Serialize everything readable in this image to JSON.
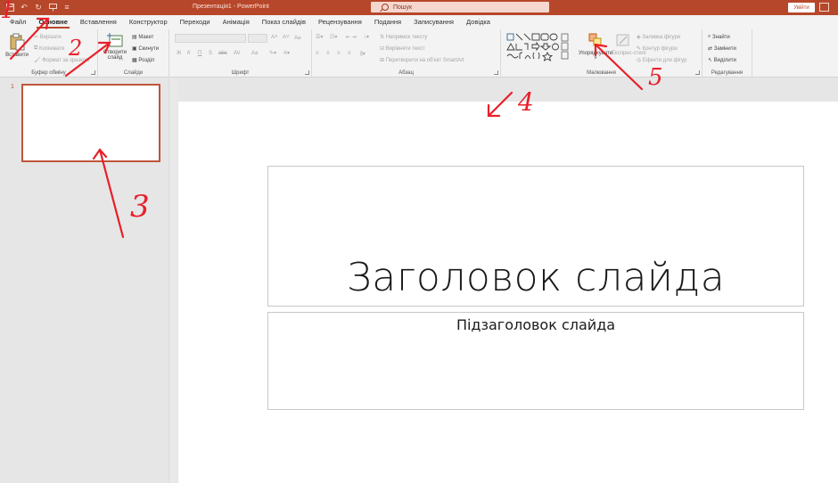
{
  "titlebar": {
    "title": "Презентація1 - PowerPoint",
    "search_placeholder": "Пошук",
    "sign_in": "Увійти",
    "icons": [
      "save-icon",
      "undo-icon",
      "redo-icon",
      "present-icon",
      "customize-icon"
    ]
  },
  "tabs": [
    {
      "label": "Файл",
      "active": false
    },
    {
      "label": "Основне",
      "active": true
    },
    {
      "label": "Вставлення",
      "active": false
    },
    {
      "label": "Конструктор",
      "active": false
    },
    {
      "label": "Переходи",
      "active": false
    },
    {
      "label": "Анімація",
      "active": false
    },
    {
      "label": "Показ слайдів",
      "active": false
    },
    {
      "label": "Рецензування",
      "active": false
    },
    {
      "label": "Подання",
      "active": false
    },
    {
      "label": "Записування",
      "active": false
    },
    {
      "label": "Довідка",
      "active": false
    }
  ],
  "ribbon": {
    "clipboard": {
      "label": "Буфер обміну",
      "paste": "Вставити",
      "cut": "Вирізати",
      "copy": "Копіювати",
      "format_painter": "Формат за зразком"
    },
    "slides": {
      "label": "Слайди",
      "new_slide_line1": "Створити",
      "new_slide_line2": "слайд",
      "layout": "Макет",
      "reset": "Скинути",
      "section": "Розділ"
    },
    "font": {
      "label": "Шрифт",
      "bold": "Ж",
      "italic": "К",
      "underline": "П",
      "strike": "S",
      "shadow": "abc",
      "spacing": "AV",
      "case": "Aa"
    },
    "paragraph": {
      "label": "Абзац",
      "text_direction": "Напрямок тексту",
      "align_text": "Вирівняти текст",
      "convert_smartart": "Перетворити на об'єкт SmartArt"
    },
    "drawing": {
      "label": "Малювання",
      "arrange": "Упорядкувати",
      "quick_styles": "Експрес-стилі",
      "shape_fill": "Заливка фігури",
      "shape_outline": "Контур фігури",
      "shape_effects": "Ефекти для фігур"
    },
    "editing": {
      "label": "Редагування",
      "find": "Знайти",
      "replace": "Замінити",
      "select": "Виділити"
    }
  },
  "thumbnails": [
    {
      "number": "1"
    }
  ],
  "slide": {
    "title_placeholder": "Заголовок слайда",
    "subtitle_placeholder": "Підзаголовок слайда"
  },
  "annotations": {
    "numbers": [
      "1",
      "2",
      "3",
      "4",
      "5"
    ],
    "color": "#e8202a"
  },
  "colors": {
    "accent": "#b7472a",
    "ribbon_bg": "#f3f3f3",
    "workspace_bg": "#e6e6e6"
  }
}
